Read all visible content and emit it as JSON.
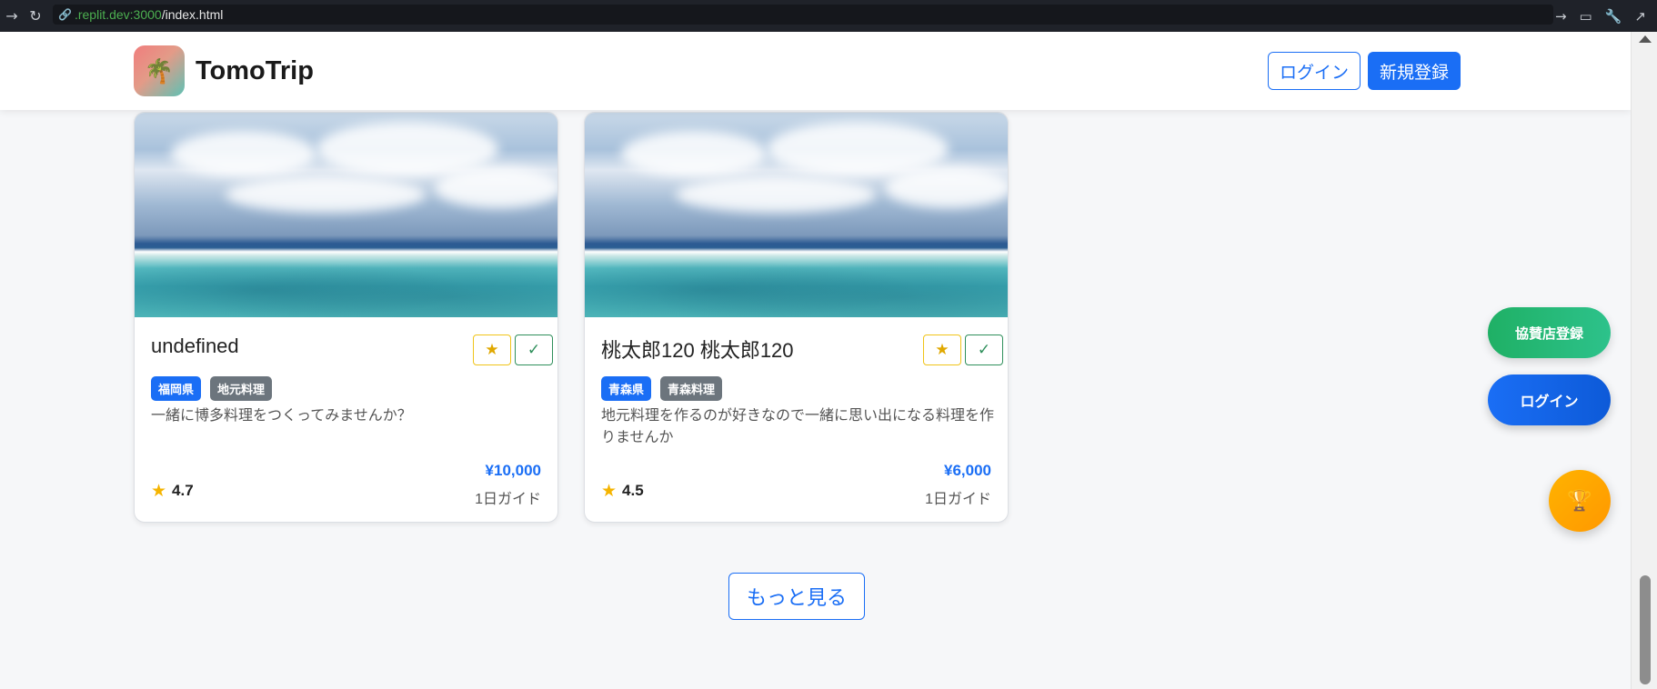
{
  "browser": {
    "back_icon": "arrow-right-icon",
    "reload_icon": "reload-icon",
    "url_domain": ".replit.dev:3000",
    "url_path": "/index.html"
  },
  "header": {
    "brand": "TomoTrip",
    "logo_icon": "🌴",
    "login_label": "ログイン",
    "signup_label": "新規登録"
  },
  "cards": [
    {
      "title": "undefined",
      "tags": [
        "福岡県",
        "地元料理"
      ],
      "description": "一緒に博多料理をつくってみませんか？",
      "rating": "4.7",
      "price": "¥10,000",
      "duration": "1日ガイド"
    },
    {
      "title": "桃太郎120 桃太郎120",
      "tags": [
        "青森県",
        "青森料理"
      ],
      "description": "地元料理を作るのが好きなので一緒に思い出になる料理を作りませんか",
      "rating": "4.5",
      "price": "¥6,000",
      "duration": "1日ガイド"
    }
  ],
  "more_label": "もっと見る",
  "floating": {
    "sponsor_label": "協賛店登録",
    "login_label": "ログイン",
    "trophy_icon": "trophy-icon"
  },
  "colors": {
    "primary": "#1a6ef5",
    "success": "#1fb065",
    "warning": "#ffb300",
    "tag_gray": "#6c757d"
  }
}
